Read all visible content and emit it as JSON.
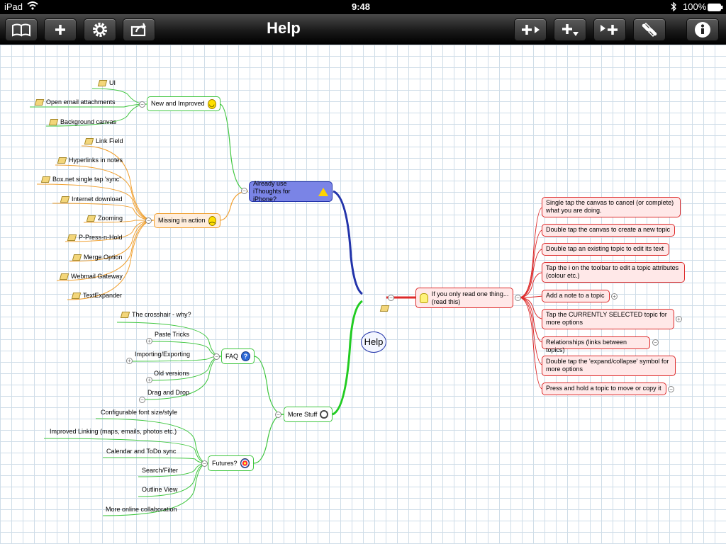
{
  "status": {
    "device": "iPad",
    "time": "9:48",
    "battery": "100%"
  },
  "toolbar": {
    "title": "Help",
    "left_icons": [
      "book-icon",
      "plus-icon",
      "gear-icon",
      "share-icon"
    ],
    "right_icons": [
      "add-child-icon",
      "add-sibling-below-icon",
      "add-parent-icon",
      "link-icon",
      "info-icon"
    ]
  },
  "central": {
    "label": "Help"
  },
  "branches": {
    "already": "Already use iThoughts for iPhone?",
    "new_improved": "New and Improved",
    "missing": "Missing in action",
    "more_stuff": "More Stuff",
    "faq": "FAQ",
    "futures": "Futures?",
    "read_this": "If you only read one thing... (read this)"
  },
  "new_items": [
    "UI",
    "Open email attachments",
    "Background canvas"
  ],
  "missing_items": [
    "Link Field",
    "Hyperlinks in notes",
    "Box.net single tap 'sync'",
    "Internet download",
    "Zooming",
    "P-Press-n-Hold",
    "Merge Option",
    "Webmail Gateway",
    "TextExpander"
  ],
  "faq_items": [
    "The crosshair - why?",
    "Paste Tricks",
    "Importing/Exporting",
    "Old versions",
    "Drag and Drop"
  ],
  "futures_items": [
    "Configurable font size/style",
    "Improved Linking (maps, emails, photos etc.)",
    "Calendar and ToDo sync",
    "Search/Filter",
    "Outline View",
    "More online collaboration"
  ],
  "tips": [
    "Single tap the canvas to cancel (or complete) what you are doing.",
    "Double tap the canvas to create a new topic",
    "Double tap an existing topic to edit its text",
    "Tap the i on the toolbar to edit a topic attributes (colour etc.)",
    "Add a note to a topic",
    "Tap the CURRENTLY SELECTED topic for more options",
    "Relationships (links between topics)",
    "Double tap the 'expand/collapse' symbol for more options",
    "Press and hold a topic to move or copy it"
  ],
  "colors": {
    "green": "#3ec63e",
    "orange": "#f0a030",
    "red": "#dd2a2a",
    "blue": "#2233aa"
  }
}
